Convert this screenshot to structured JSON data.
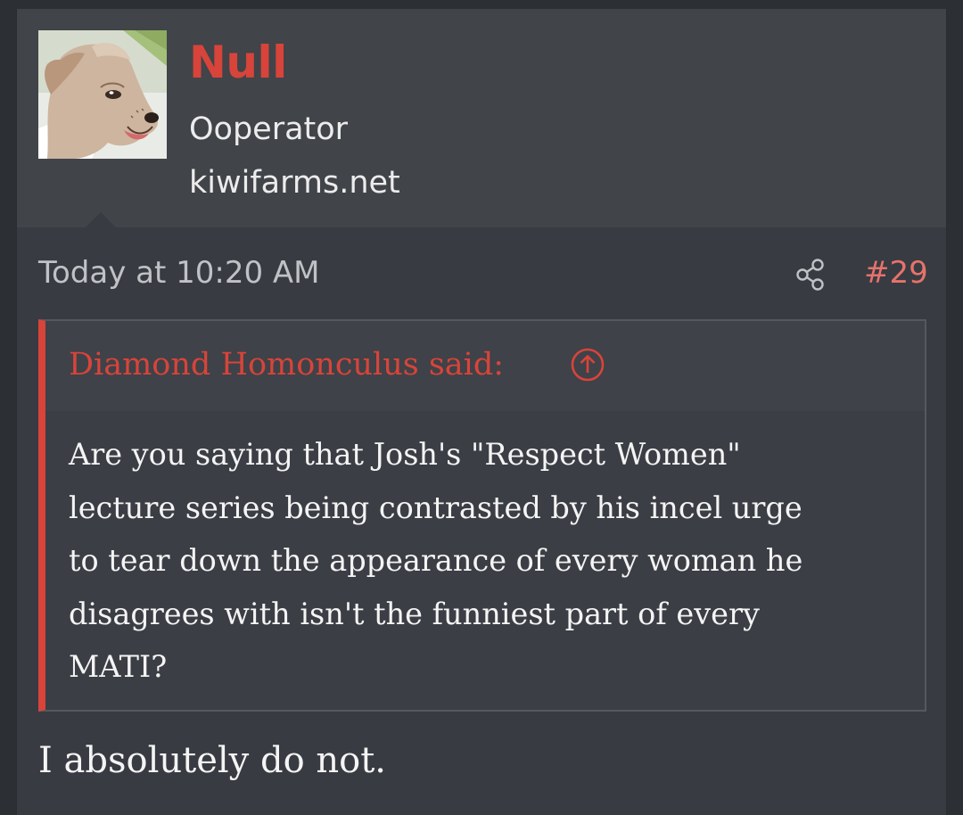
{
  "author": {
    "username": "Null",
    "user_title": "Ooperator",
    "user_extra": "kiwifarms.net",
    "avatar_icon": "dog-avatar"
  },
  "post": {
    "date": "Today at 10:20 AM",
    "share_icon": "share-icon",
    "number": "#29",
    "body": "I absolutely do not."
  },
  "quote": {
    "author_line": "Diamond Homonculus said:",
    "expand_icon": "arrow-up-circle-icon",
    "text": "Are you saying that Josh's \"Respect Women\"\nlecture series being contrasted by his incel urge\nto tear down the appearance of every woman he\ndisagrees with isn't the funniest part of every\nMATI?"
  },
  "colors": {
    "accent": "#d8443a",
    "post_number": "#e6736b",
    "background": "#383b42",
    "user_block": "#414449"
  }
}
